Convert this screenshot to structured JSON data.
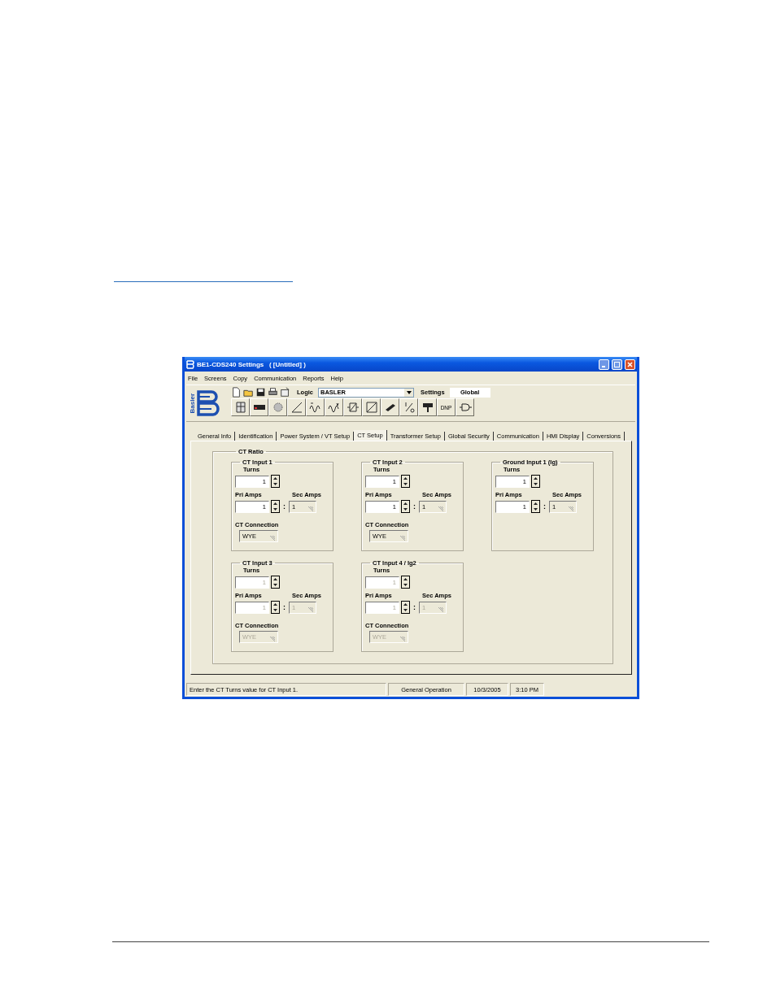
{
  "window": {
    "title": "BE1-CDS240 Settings   ( [Untitled] )"
  },
  "menu": [
    "File",
    "Screens",
    "Copy",
    "Communication",
    "Reports",
    "Help"
  ],
  "toolbar": {
    "logo_text": "Basler",
    "logic_label": "Logic",
    "logic_value": "BASLER",
    "settings_label": "Settings",
    "settings_value": "Global",
    "dnp_button": "DNP"
  },
  "tabs": [
    {
      "label": "General Info",
      "selected": false
    },
    {
      "label": "Identification",
      "selected": false
    },
    {
      "label": "Power System / VT Setup",
      "selected": false
    },
    {
      "label": "CT Setup",
      "selected": true
    },
    {
      "label": "Transformer Setup",
      "selected": false
    },
    {
      "label": "Global Security",
      "selected": false
    },
    {
      "label": "Communication",
      "selected": false
    },
    {
      "label": "HMI Display",
      "selected": false
    },
    {
      "label": "Conversions",
      "selected": false
    }
  ],
  "ct_ratio": {
    "title": "CT Ratio",
    "inputs": [
      {
        "title": "CT Input 1",
        "disabled": false,
        "turns_label": "Turns",
        "turns": "1",
        "pri_label": "Pri Amps",
        "pri": "1",
        "separator": ":",
        "sec_label": "Sec Amps",
        "sec": "1",
        "connection_label": "CT Connection",
        "connection": "WYE"
      },
      {
        "title": "CT Input 2",
        "disabled": false,
        "turns_label": "Turns",
        "turns": "1",
        "pri_label": "Pri Amps",
        "pri": "1",
        "separator": ":",
        "sec_label": "Sec Amps",
        "sec": "1",
        "connection_label": "CT Connection",
        "connection": "WYE"
      },
      {
        "title": "Ground Input 1 (Ig)",
        "disabled": false,
        "turns_label": "Turns",
        "turns": "1",
        "pri_label": "Pri Amps",
        "pri": "1",
        "separator": ":",
        "sec_label": "Sec Amps",
        "sec": "1"
      },
      {
        "title": "CT Input 3",
        "disabled": true,
        "turns_label": "Turns",
        "turns": "1",
        "pri_label": "Pri Amps",
        "pri": "1",
        "separator": ":",
        "sec_label": "Sec Amps",
        "sec": "1",
        "connection_label": "CT Connection",
        "connection": "WYE"
      },
      {
        "title": "CT Input 4 / Ig2",
        "disabled": true,
        "turns_label": "Turns",
        "turns": "1",
        "pri_label": "Pri Amps",
        "pri": "1",
        "separator": ":",
        "sec_label": "Sec Amps",
        "sec": "1",
        "connection_label": "CT Connection",
        "connection": "WYE"
      }
    ]
  },
  "status_bar": {
    "message": "Enter the CT Turns value for CT Input 1.",
    "mode": "General Operation",
    "date": "10/3/2005",
    "time": "3:10 PM"
  }
}
